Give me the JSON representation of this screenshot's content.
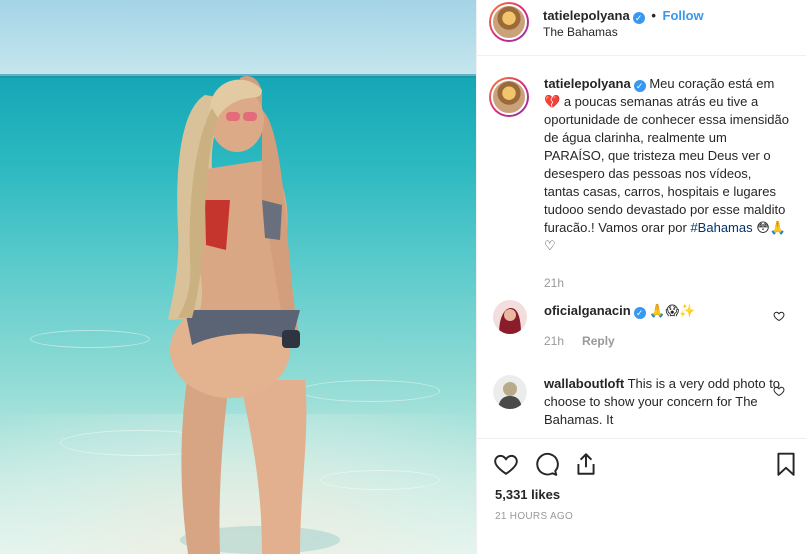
{
  "post": {
    "author": "tatielepolyana",
    "follow_label": "Follow",
    "separator": "•",
    "location": "The Bahamas"
  },
  "caption": {
    "author": "tatielepolyana",
    "text_1": "Meu coração está em",
    "text_2": "a poucas semanas atrás eu tive a oportunidade de conhecer essa imensidão de água clarinha, realmente um PARAÍSO, que tristeza meu Deus ver o desespero das pessoas nos vídeos, tantas casas, carros, hospitais e lugares tudooo sendo devastado por esse maldito furacão.! Vamos orar por",
    "hashtag": "#Bahamas",
    "emojis": "😳🙏♡",
    "time": "21h"
  },
  "comments": [
    {
      "user": "oficialganacin",
      "text": "🙏😱✨",
      "time": "21h",
      "reply_label": "Reply"
    },
    {
      "user": "wallaboutloft",
      "text": "This is a very odd photo to choose to show your concern for The Bahamas. It"
    }
  ],
  "footer": {
    "likes": "5,331 likes",
    "timestamp": "21 HOURS AGO"
  },
  "colors": {
    "link": "#3897f0",
    "text": "#262626",
    "muted": "#999999",
    "hashtag": "#003569"
  }
}
